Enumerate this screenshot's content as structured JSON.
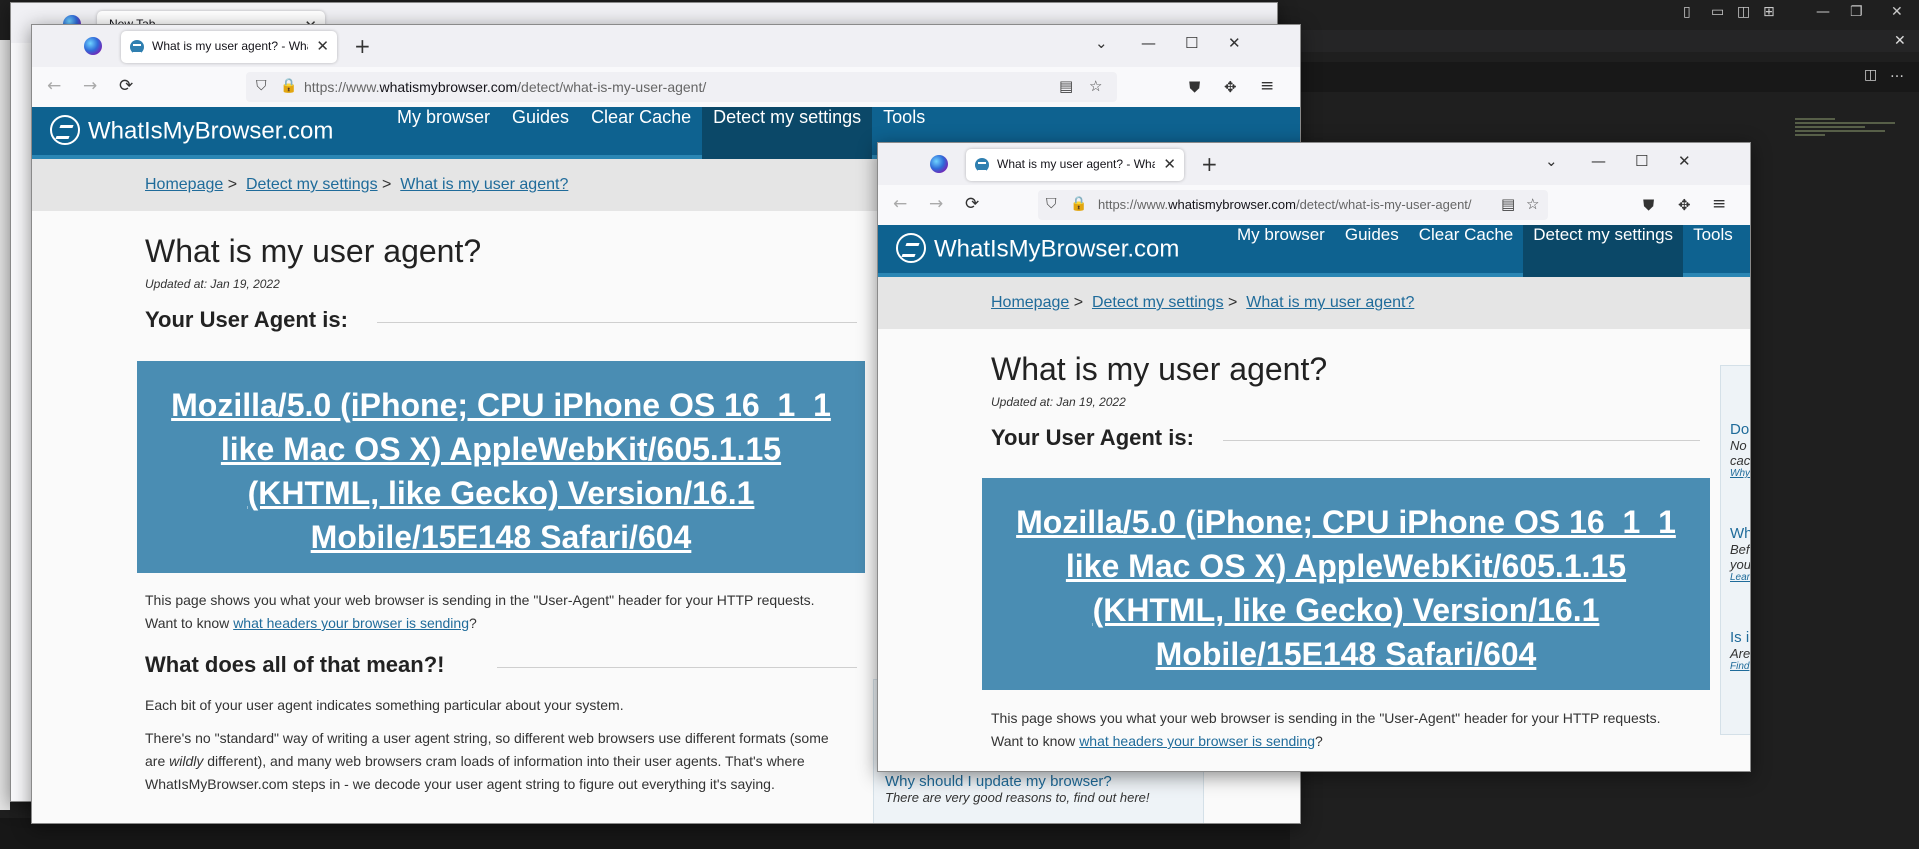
{
  "back_window": {
    "tab_title": "New Tab"
  },
  "browser": {
    "tab_title": "What is my user agent? - What is my browser",
    "url_prefix": "https://www.",
    "url_domain": "whatismybrowser.com",
    "url_path": "/detect/what-is-my-user-agent/"
  },
  "site": {
    "brand": "WhatIsMyBrowser.com",
    "menu": [
      "My browser",
      "Guides",
      "Clear Cache",
      "Detect my settings",
      "Tools"
    ],
    "breadcrumbs": [
      "Homepage",
      "Detect my settings",
      "What is my user agent?"
    ],
    "breadcrumb_sep": ">",
    "title": "What is my user agent?",
    "updated": "Updated at: Jan 19, 2022",
    "ua_heading": "Your User Agent is:",
    "ua_lines": [
      "Mozilla/5.0 (iPhone; CPU iPhone OS 16_1_1",
      "like Mac OS X) AppleWebKit/605.1.15",
      "(KHTML, like Gecko) Version/16.1",
      "Mobile/15E148 Safari/604"
    ],
    "intro_text": "This page shows you what your web browser is sending in the \"User-Agent\" header for your HTTP requests.",
    "intro_want": "Want to know ",
    "intro_link": "what headers your browser is sending",
    "intro_q": "?",
    "meaning_heading": "What does all of that mean?!",
    "meaning_p1": "Each bit of your user agent indicates something particular about your system.",
    "meaning_p2a": "There's no \"standard\" way of writing a user agent string, so different web browsers use different formats (some are ",
    "meaning_p2_em": "wildly",
    "meaning_p2b": " different), and many web browsers cram loads of information into their user agents. That's where WhatIsMyBrowser.com steps in - we decode your user agent string to figure out everything it's saying.",
    "sidebar": {
      "items": [
        {
          "title": "Do",
          "desc": [
            "No",
            "cac"
          ],
          "link": "Why"
        },
        {
          "title": "Wh",
          "desc": [
            "Bef",
            "you"
          ],
          "link": "Lear"
        },
        {
          "title": "Is i",
          "desc": [
            "Are"
          ],
          "link": "Find"
        }
      ],
      "update_title": "Why should I update my browser?",
      "update_desc": "There are very good reasons to, find out here!"
    }
  },
  "colors": {
    "header": "#0e6290",
    "active_menu": "#0b4868",
    "ua_box": "#4a8db3",
    "link": "#1f6b9a"
  },
  "icons": {
    "back": "←",
    "forward": "→",
    "reload": "⟳",
    "shield": "⛉",
    "lock": "🔒",
    "reader": "▤",
    "star": "☆",
    "pocket": "⛊",
    "extensions": "✥",
    "menu": "≡",
    "minimize": "—",
    "maximize": "☐",
    "close": "✕",
    "tab_close": "✕",
    "new_tab": "+",
    "list_tabs": "⌄"
  }
}
